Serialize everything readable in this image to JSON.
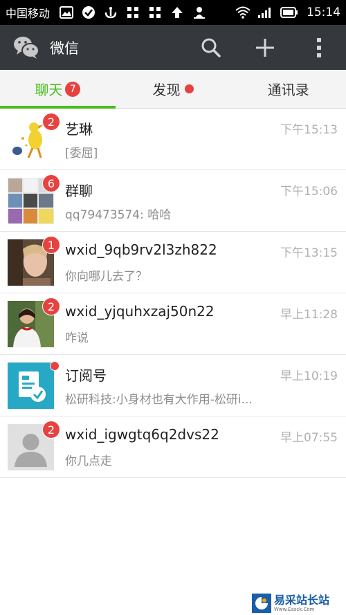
{
  "status_bar": {
    "carrier": "中国移动",
    "time": "15:14"
  },
  "app_bar": {
    "title": "微信",
    "icons": [
      "wechat-logo-icon",
      "search-icon",
      "plus-icon",
      "more-vertical-icon"
    ]
  },
  "tabs": [
    {
      "label": "聊天",
      "badge": "7",
      "active": true
    },
    {
      "label": "发现",
      "dot": true,
      "active": false
    },
    {
      "label": "通讯录",
      "active": false
    }
  ],
  "chats": [
    {
      "name": "艺琳",
      "preview": "[委屈]",
      "time": "下午15:13",
      "badge": "2"
    },
    {
      "name": "群聊",
      "preview": "qq79473574: 哈哈",
      "time": "下午15:06",
      "badge": "6"
    },
    {
      "name": "wxid_9qb9rv2l3zh822",
      "preview": "你向哪儿去了？",
      "time": "下午13:15",
      "badge": "1"
    },
    {
      "name": "wxid_yjquhxzaj50n22",
      "preview": "咋说",
      "time": "早上11:28",
      "badge": "2"
    },
    {
      "name": "订阅号",
      "preview": "松研科技:小身材也有大作用-松研i...",
      "time": "早上10:19",
      "badge": ""
    },
    {
      "name": "wxid_igwgtq6q2dvs22",
      "preview": "你几点走",
      "time": "早上07:55",
      "badge": "2"
    }
  ],
  "watermark": {
    "main": "易采站长站",
    "sub": "Www.Easck.Com"
  },
  "colors": {
    "accent": "#45c01a",
    "badge": "#e64340",
    "app_bar": "#35383d"
  }
}
